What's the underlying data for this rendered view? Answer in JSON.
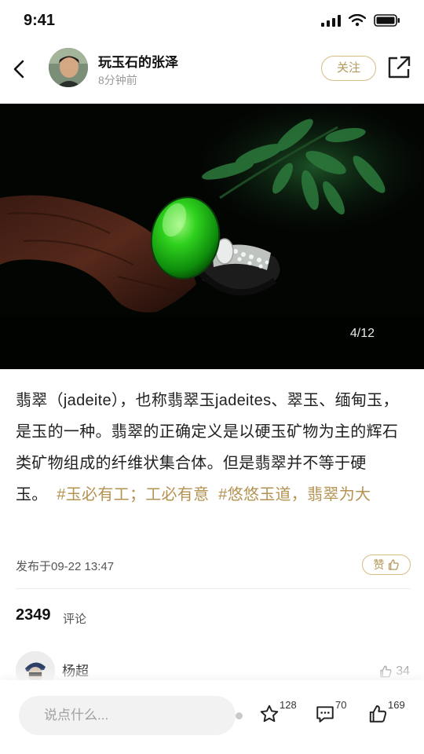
{
  "status_bar": {
    "time": "9:41"
  },
  "header": {
    "author_name": "玩玉石的张泽",
    "post_time": "8分钟前",
    "follow_label": "关注"
  },
  "photo": {
    "counter": "4/12"
  },
  "post": {
    "body": "翡翠（jadeite），也称翡翠玉jadeites、翠玉、缅甸玉，是玉的一种。翡翠的正确定义是以硬玉矿物为主的辉石类矿物组成的纤维状集合体。但是翡翠并不等于硬玉。",
    "hashtag_1": "#玉必有工；工必有意",
    "hashtag_2": "#悠悠玉道，翡翠为大",
    "publish_time": "发布于09-22 13:47",
    "like_label": "赞"
  },
  "comments": {
    "count": "2349",
    "label": "评论",
    "first": {
      "name": "杨超",
      "likes": "34"
    }
  },
  "bottom_bar": {
    "input_placeholder": "说点什么...",
    "favorites": "128",
    "comments": "70",
    "likes": "169"
  },
  "colors": {
    "accent_gold": "#b49250",
    "jade_green": "#22c21c",
    "text_dark": "#222222"
  },
  "icons": [
    "back-arrow-icon",
    "share-icon",
    "thumbs-up-icon",
    "star-icon",
    "comment-icon"
  ]
}
